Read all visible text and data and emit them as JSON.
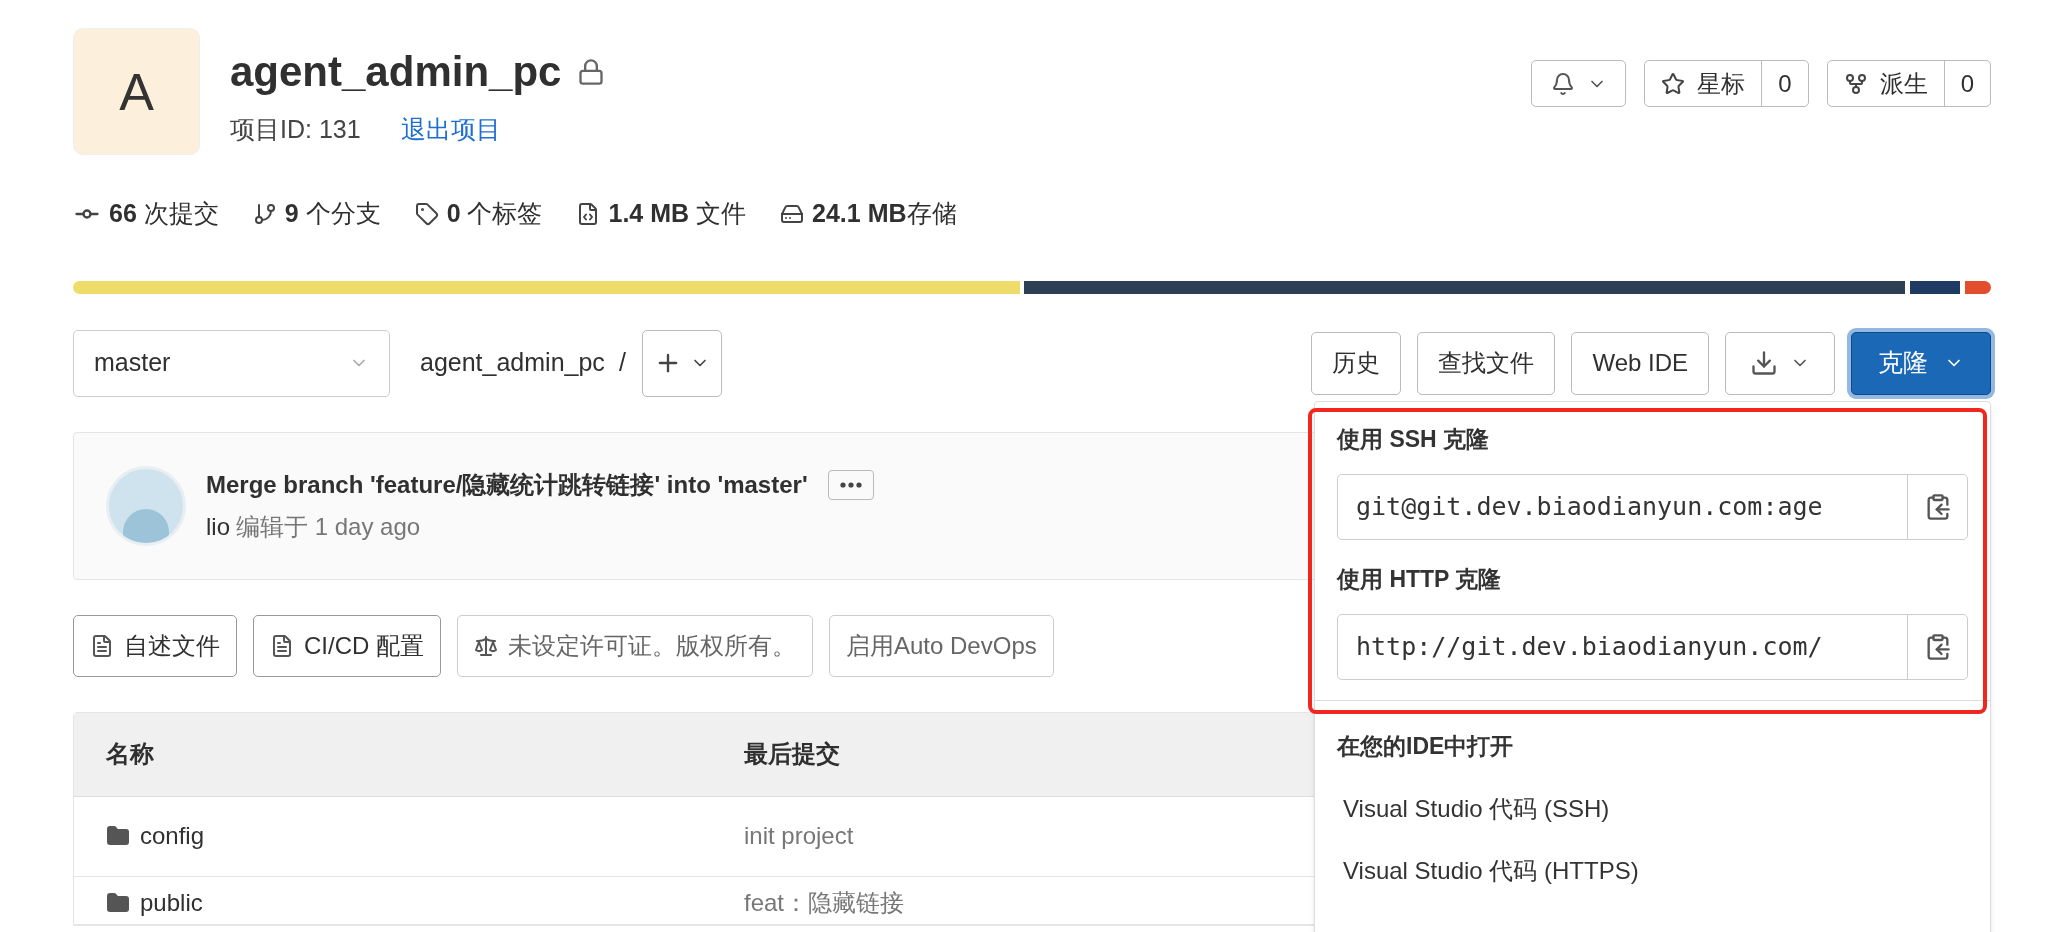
{
  "project": {
    "avatar_letter": "A",
    "name": "agent_admin_pc",
    "private": true,
    "id_label": "项目ID: 131",
    "leave_link": "退出项目"
  },
  "header_actions": {
    "star_label": "星标",
    "star_count": "0",
    "fork_label": "派生",
    "fork_count": "0"
  },
  "stats": [
    {
      "kind": "commits",
      "text": "**66** 次提交"
    },
    {
      "kind": "branches",
      "text": "**9** 个分支"
    },
    {
      "kind": "tags",
      "text": "**0** 个标签"
    },
    {
      "kind": "files",
      "text": "**1.4 MB** 文件"
    },
    {
      "kind": "storage",
      "text": "**24.1 MB**存储"
    }
  ],
  "toolbar": {
    "branch": "master",
    "path": "agent_admin_pc",
    "separator": "/",
    "buttons": [
      {
        "kind": "text",
        "label": "历史"
      },
      {
        "kind": "text",
        "label": "查找文件"
      },
      {
        "kind": "text",
        "label": "Web IDE"
      },
      {
        "kind": "download"
      },
      {
        "kind": "primary",
        "label": "克隆",
        "expanded": true
      }
    ]
  },
  "commit": {
    "title": "Merge branch 'feature/隐藏统计跳转链接' into 'master'",
    "author": "lio",
    "meta": "编辑于 1 day ago"
  },
  "quick_links": [
    {
      "kind": "file",
      "label": "自述文件"
    },
    {
      "kind": "file",
      "label": "CI/CD 配置"
    },
    {
      "kind": "license",
      "label": "未设定许可证。版权所有。"
    },
    {
      "kind": "plain",
      "label": "启用Auto DevOps"
    }
  ],
  "table": {
    "columns": [
      "名称",
      "最后提交"
    ],
    "rows": [
      {
        "name": "config",
        "last_commit": "init project"
      },
      {
        "name": "public",
        "last_commit": "feat：隐藏链接"
      }
    ]
  },
  "clone_menu": {
    "highlighted": true,
    "sections": [
      {
        "title": "使用 SSH 克隆",
        "value": "git@git.dev.biaodianyun.com:age"
      },
      {
        "title": "使用 HTTP 克隆",
        "value": "http://git.dev.biaodianyun.com/"
      }
    ],
    "ide_title": "在您的IDE中打开",
    "ide_items": [
      "Visual Studio 代码 (SSH)",
      "Visual Studio 代码 (HTTPS)"
    ]
  }
}
